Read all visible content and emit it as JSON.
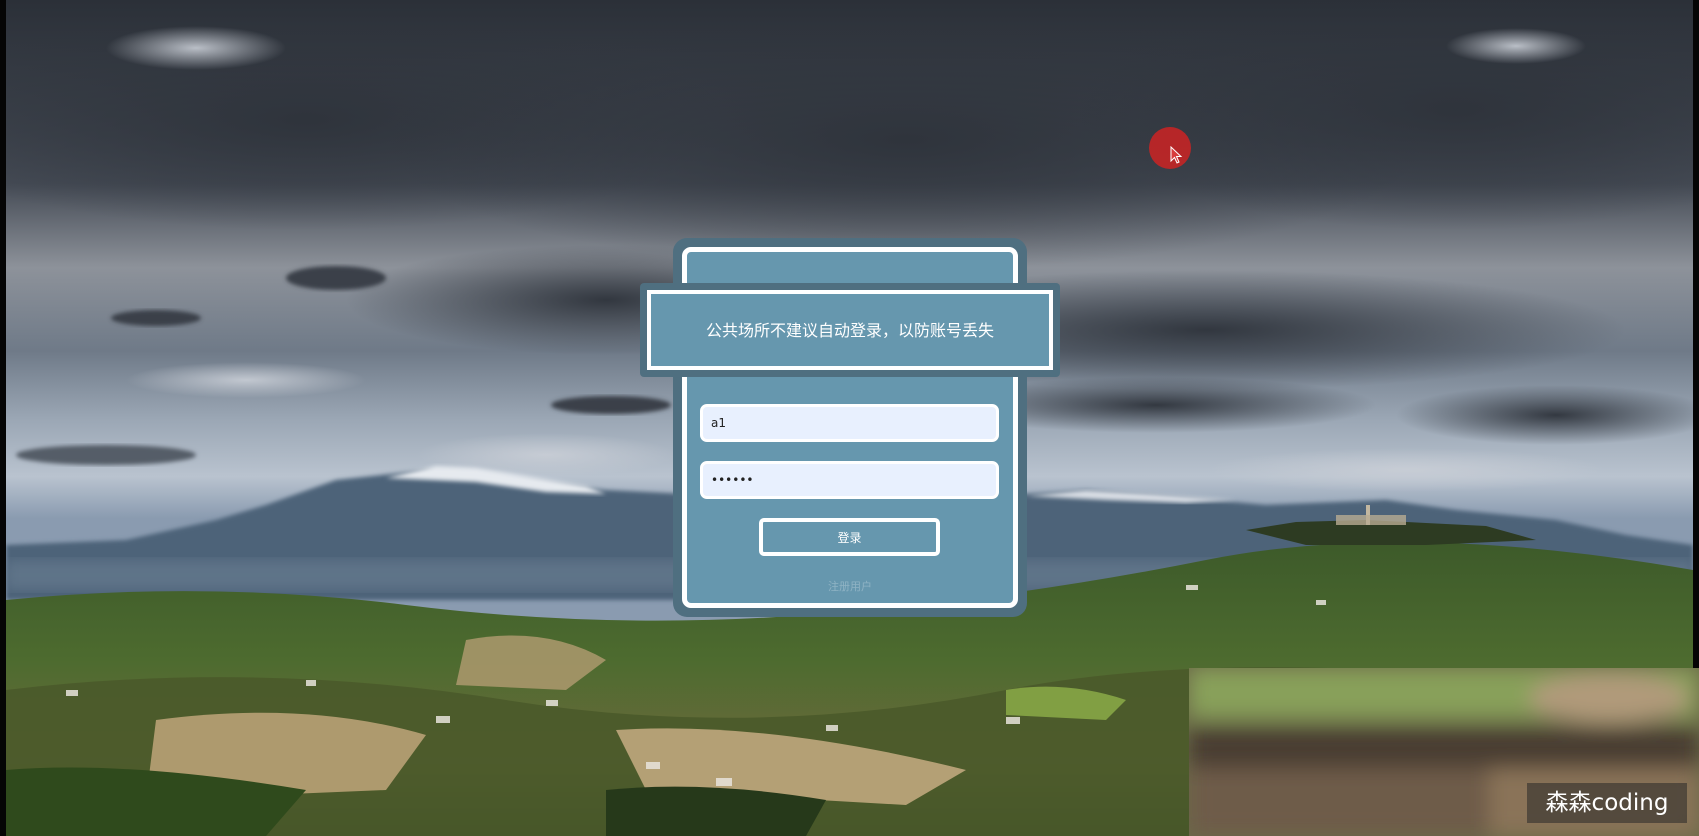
{
  "notice": {
    "text": "公共场所不建议自动登录，以防账号丢失"
  },
  "login_form": {
    "username_value": "a1",
    "password_value": "••••••",
    "submit_label": "登录",
    "register_label": "注册用户"
  },
  "overlay": {
    "watermark_text": "森森coding"
  },
  "colors": {
    "card_outer": "#4f6f80",
    "card_inner": "#6697ae",
    "input_bg": "#e8f0fe",
    "border": "#ffffff",
    "cursor_highlight": "#cd2323"
  }
}
